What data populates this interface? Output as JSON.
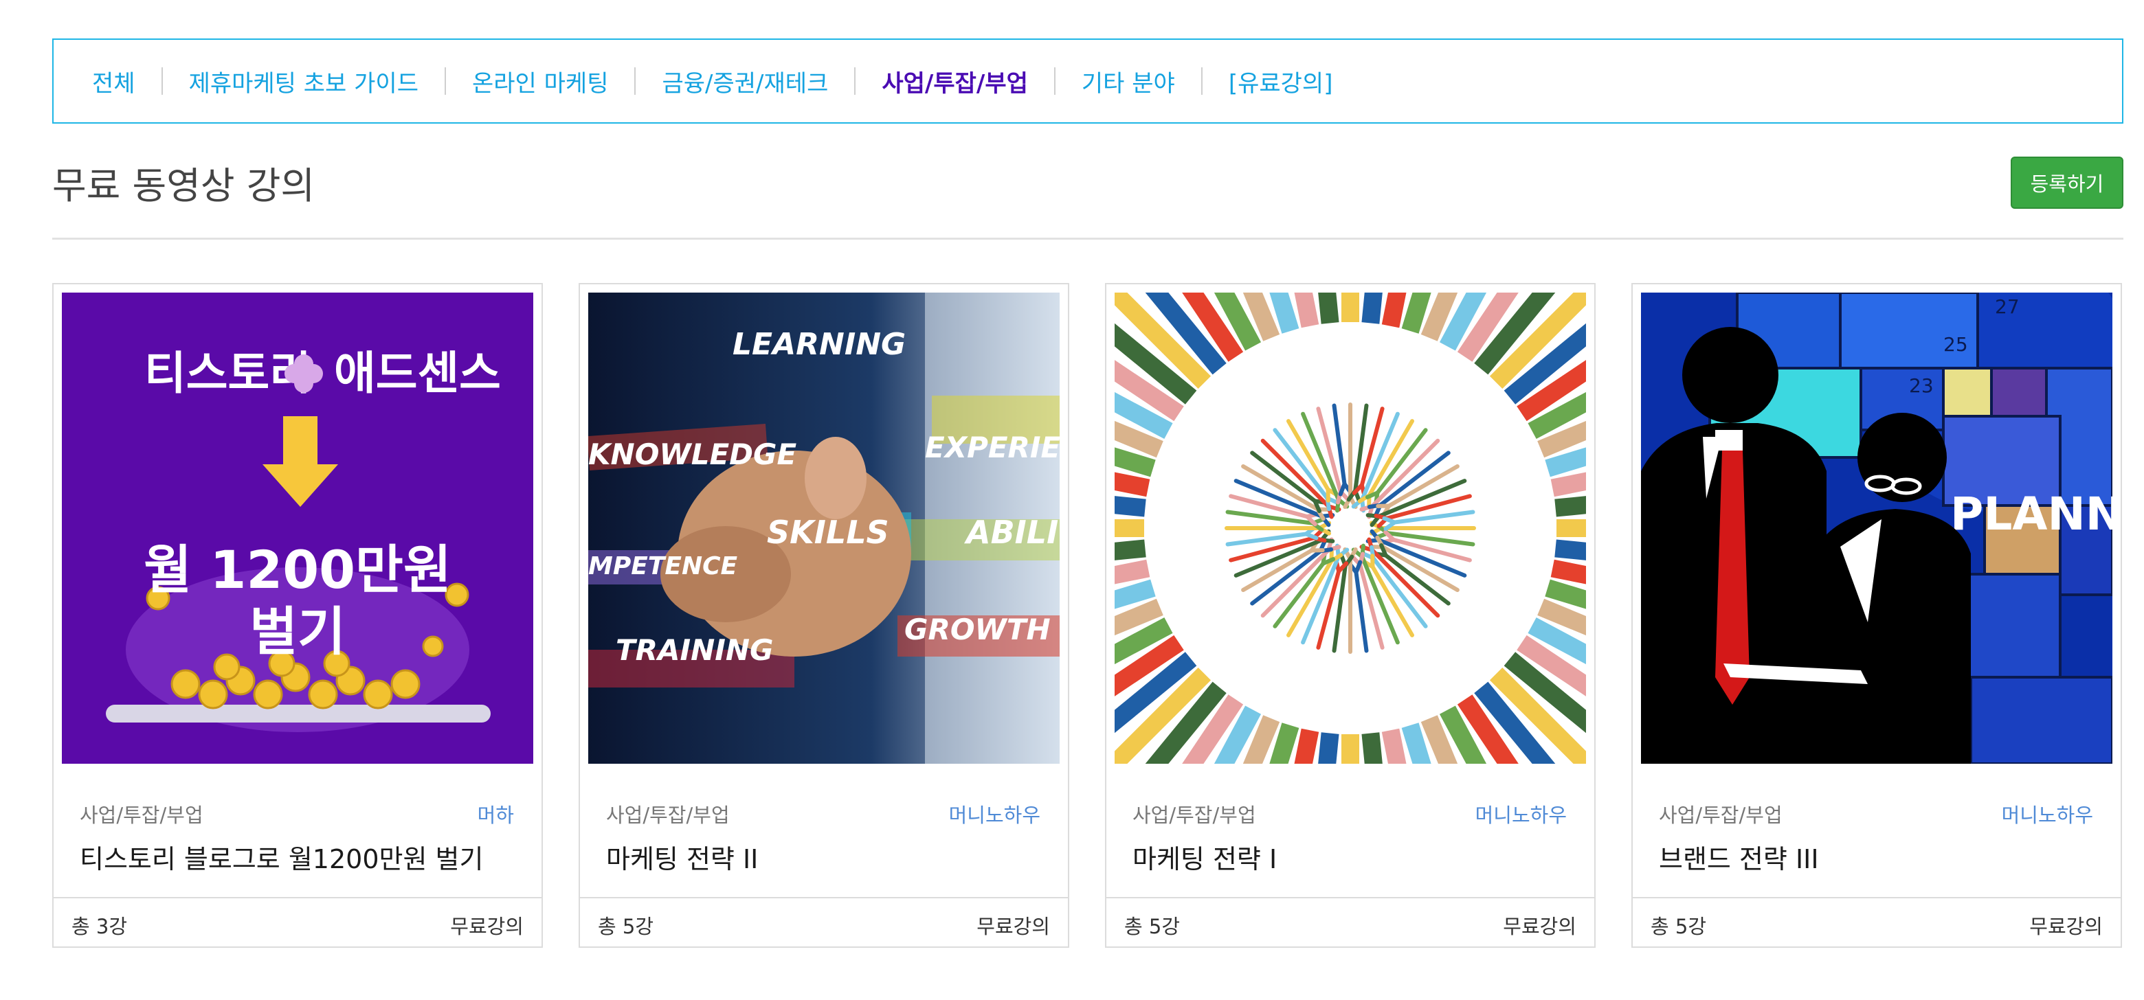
{
  "nav": {
    "items": [
      {
        "label": "전체"
      },
      {
        "label": "제휴마케팅 초보 가이드"
      },
      {
        "label": "온라인 마케팅"
      },
      {
        "label": "금융/증권/재테크"
      },
      {
        "label": "사업/투잡/부업",
        "active": true
      },
      {
        "label": "기타 분야"
      },
      {
        "label": "[유료강의]"
      }
    ]
  },
  "header": {
    "title": "무료 동영상 강의",
    "register_label": "등록하기"
  },
  "cards": [
    {
      "category": "사업/투잡/부업",
      "author": "머하",
      "title": "티스토리 블로그로 월1200만원 벌기",
      "count": "총 3강",
      "price": "무료강의",
      "thumb": {
        "line1": "티스토리",
        "line2": "애드센스",
        "line3": "월 1200만원",
        "line4": "벌기"
      }
    },
    {
      "category": "사업/투잡/부업",
      "author": "머니노하우",
      "title": "마케팅 전략 II",
      "count": "총 5강",
      "price": "무료강의",
      "thumb": {
        "words": [
          "LEARNING",
          "KNOWLEDGE",
          "EXPERIE",
          "SKILLS",
          "ABILI",
          "MPETENCE",
          "GROWTH",
          "TRAINING"
        ]
      }
    },
    {
      "category": "사업/투잡/부업",
      "author": "머니노하우",
      "title": "마케팅 전략 I",
      "count": "총 5강",
      "price": "무료강의"
    },
    {
      "category": "사업/투잡/부업",
      "author": "머니노하우",
      "title": "브랜드 전략 III",
      "count": "총 5강",
      "price": "무료강의",
      "thumb": {
        "sign": "PLANN",
        "clock_numbers": [
          "23",
          "25",
          "27"
        ]
      }
    }
  ]
}
